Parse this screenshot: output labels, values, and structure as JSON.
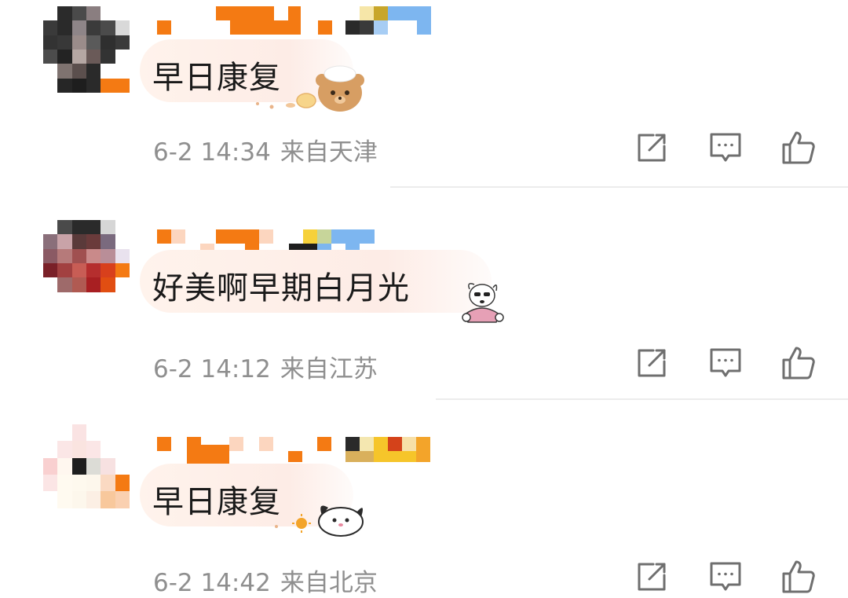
{
  "comments": [
    {
      "text": "早日康复",
      "time": "6-2 14:34",
      "location": "来自天津"
    },
    {
      "text": "好美啊早期白月光",
      "time": "6-2 14:12",
      "location": "来自江苏"
    },
    {
      "text": "早日康复",
      "time": "6-2 14:42",
      "location": "来自北京"
    }
  ],
  "icons": {
    "share": "share-icon",
    "reply": "comment-icon",
    "like": "thumbs-up-icon"
  },
  "colors": {
    "meta_text": "#8f8f8f",
    "icon": "#6f6f6f",
    "accent_orange": "#f47a13",
    "accent_blue": "#7db6f0"
  }
}
